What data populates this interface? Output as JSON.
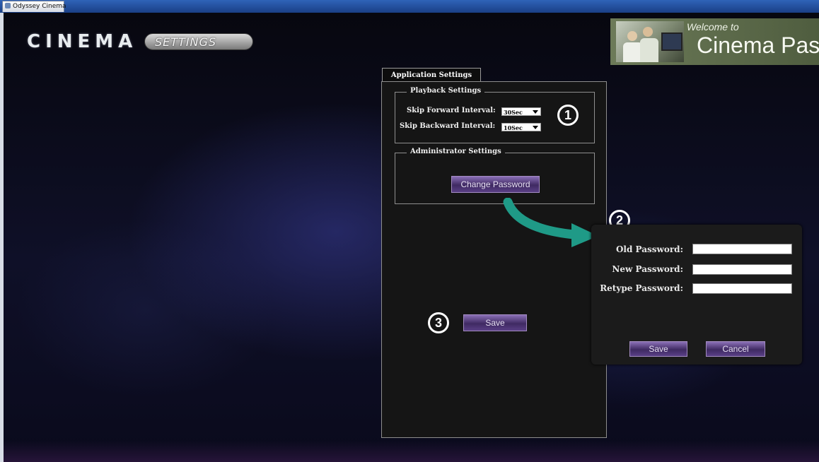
{
  "window": {
    "title": "Odyssey Cinema"
  },
  "logo": {
    "cinema": "CINEMA",
    "settings": "SETTINGS"
  },
  "banner": {
    "welcome": "Welcome to",
    "title": "Cinema Pas"
  },
  "settings_panel": {
    "tab": "Application Settings",
    "playback": {
      "legend": "Playback Settings",
      "skip_forward_label": "Skip Forward Interval:",
      "skip_forward_value": "30Sec",
      "skip_backward_label": "Skip Backward Interval:",
      "skip_backward_value": "10Sec"
    },
    "admin": {
      "legend": "Administrator Settings",
      "change_password_label": "Change Password"
    },
    "save_label": "Save"
  },
  "password_dialog": {
    "old_label": "Old Password:",
    "new_label": "New Password:",
    "retype_label": "Retype Password:",
    "save_label": "Save",
    "cancel_label": "Cancel"
  },
  "callouts": {
    "one": "1",
    "two": "2",
    "three": "3"
  },
  "colors": {
    "button_purple": "#5a3f86",
    "arrow_teal": "#1f9a87",
    "banner_green": "#5d6b4a"
  }
}
